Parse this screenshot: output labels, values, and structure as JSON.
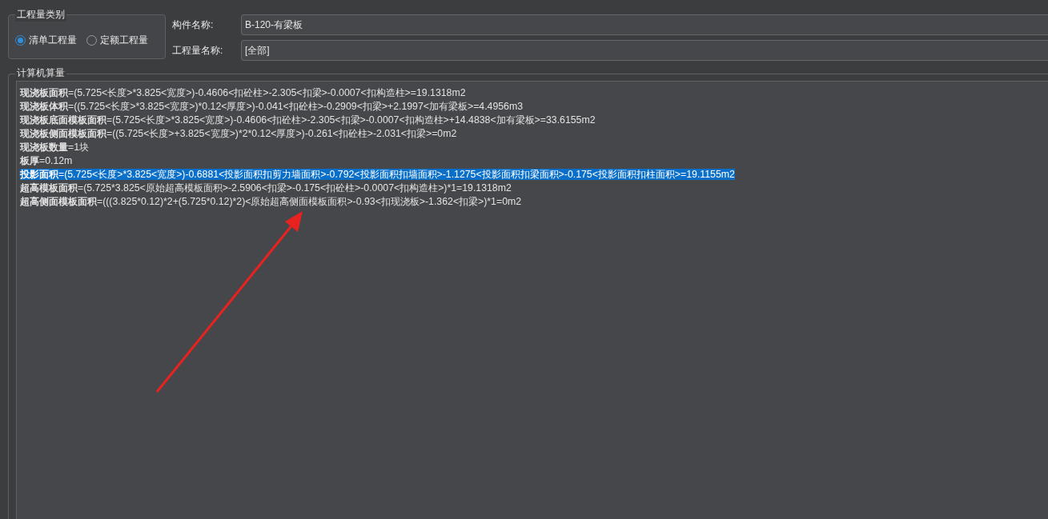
{
  "quantity_type": {
    "legend": "工程量类别",
    "options": [
      {
        "label": "清单工程量",
        "selected": true
      },
      {
        "label": "定额工程量",
        "selected": false
      }
    ]
  },
  "fields": [
    {
      "label": "构件名称:",
      "value": "B-120-有梁板"
    },
    {
      "label": "工程量名称:",
      "value": "[全部]"
    }
  ],
  "calculation": {
    "legend": "计算机算量",
    "lines": [
      {
        "text": "**现浇板面积**=(5.725<长度>*3.825<宽度>)-0.4606<扣砼柱>-2.305<扣梁>-0.0007<扣构造柱>=19.1318m2",
        "selected": false
      },
      {
        "text": "**现浇板体积**=((5.725<长度>*3.825<宽度>)*0.12<厚度>)-0.041<扣砼柱>-0.2909<扣梁>+2.1997<加有梁板>=4.4956m3",
        "selected": false
      },
      {
        "text": "**现浇板底面模板面积**=(5.725<长度>*3.825<宽度>)-0.4606<扣砼柱>-2.305<扣梁>-0.0007<扣构造柱>+14.4838<加有梁板>=33.6155m2",
        "selected": false
      },
      {
        "text": "**现浇板侧面模板面积**=((5.725<长度>+3.825<宽度>)*2*0.12<厚度>)-0.261<扣砼柱>-2.031<扣梁>=0m2",
        "selected": false
      },
      {
        "text": "**现浇板数量**=1块",
        "selected": false
      },
      {
        "text": "**板厚**=0.12m",
        "selected": false
      },
      {
        "text": "**投影面积**=(5.725<长度>*3.825<宽度>)-0.6881<投影面积扣剪力墙面积>-0.792<投影面积扣墙面积>-1.1275<投影面积扣梁面积>-0.175<投影面积扣柱面积>=19.1155m2",
        "selected": true
      },
      {
        "text": "**超高模板面积**=(5.725*3.825<原始超高模板面积>-2.5906<扣梁>-0.175<扣砼柱>-0.0007<扣构造柱>)*1=19.1318m2",
        "selected": false
      },
      {
        "text": "**超高侧面模板面积**=(((3.825*0.12)*2+(5.725*0.12)*2)<原始超高侧面模板面积>-0.93<扣现浇板>-1.362<扣梁>)*1=0m2",
        "selected": false
      }
    ]
  }
}
